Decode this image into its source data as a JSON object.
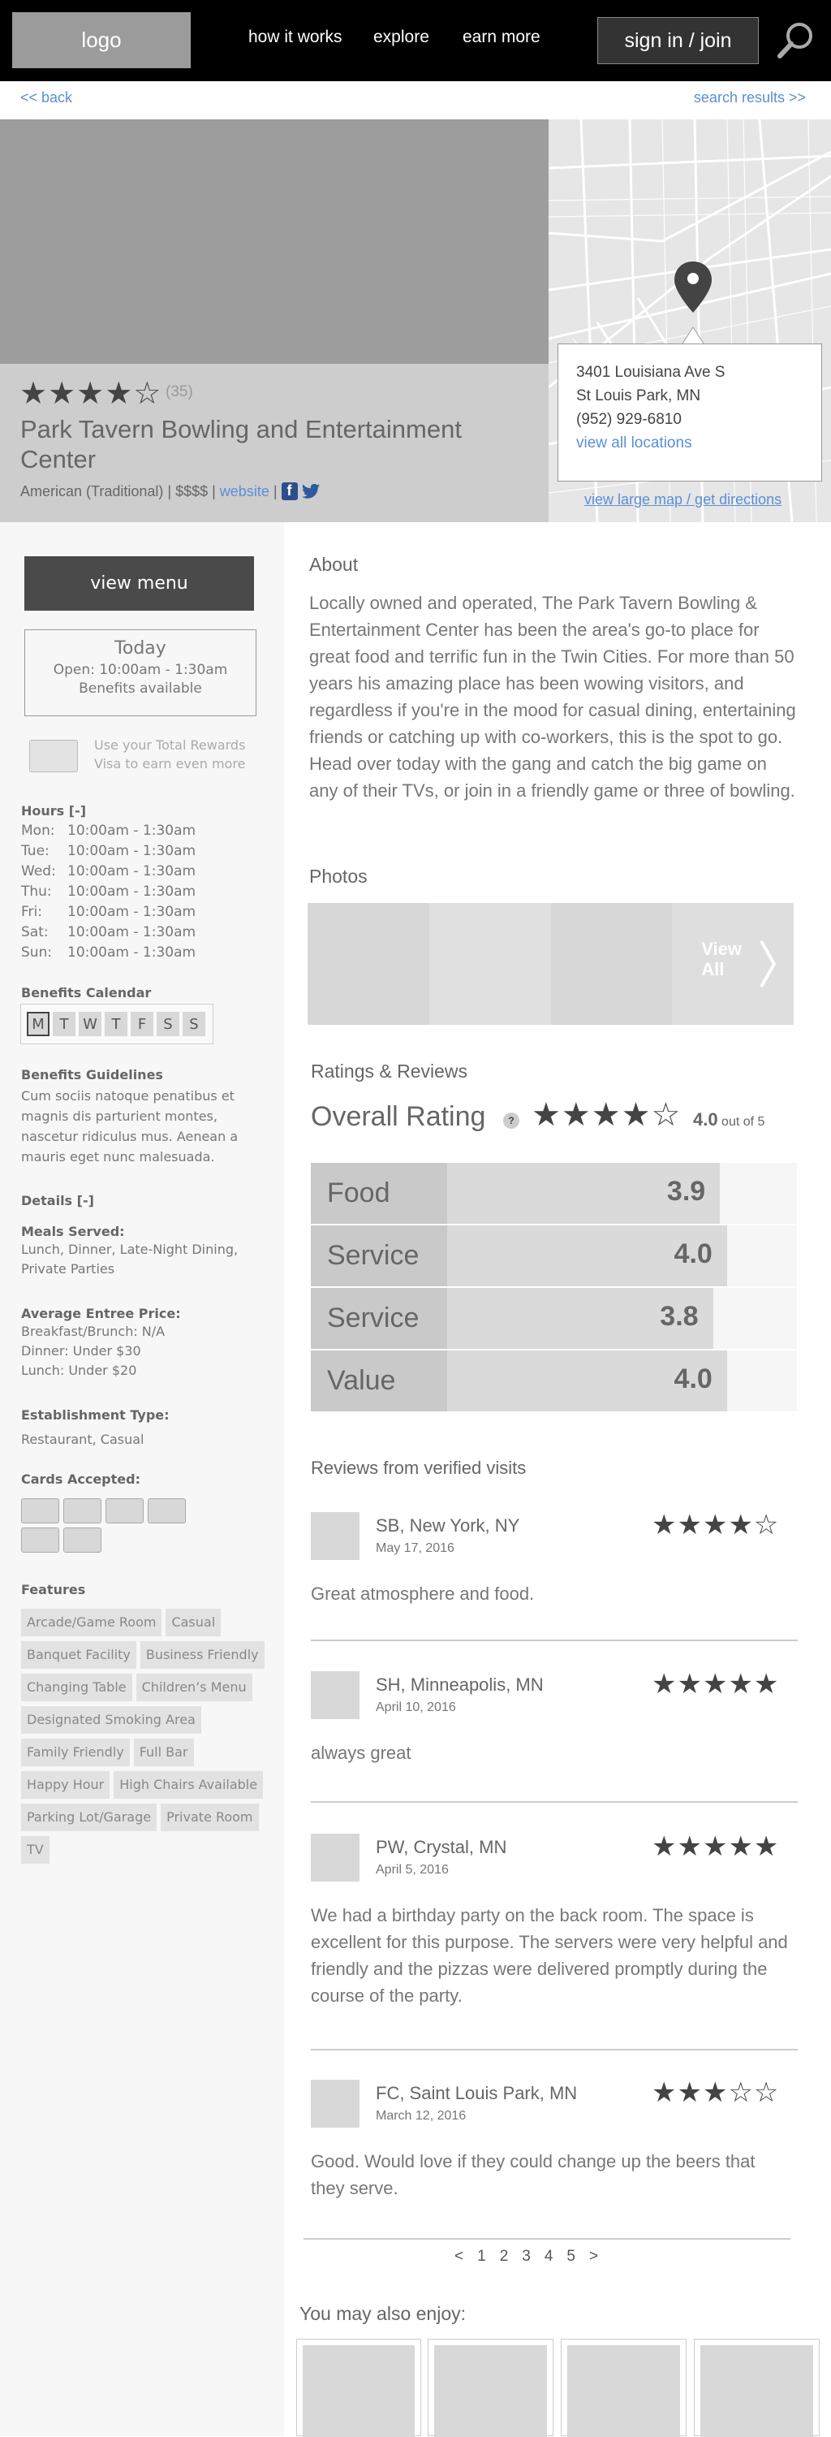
{
  "header": {
    "logo": "logo",
    "nav": [
      "how it works",
      "explore",
      "earn more"
    ],
    "signin": "sign in / join",
    "search_icon": "search-icon"
  },
  "subnav": {
    "back": "<< back",
    "results": "search results >>"
  },
  "venue": {
    "stars": "★★★★☆",
    "rating": 4,
    "review_count": "(35)",
    "name": "Park Tavern Bowling and Entertainment Center",
    "cuisine": "American (Traditional) | $$$$ |",
    "website": "website",
    "sep": "|"
  },
  "location": {
    "address1": "3401 Louisiana Ave S",
    "address2": "St Louis Park, MN",
    "phone": "(952) 929-6810",
    "all_locations": "view all locations",
    "large_map": "view large map / get directions"
  },
  "sidebar": {
    "menu_button": "view menu",
    "today": {
      "title": "Today",
      "open": "Open: 10:00am - 1:30am",
      "benefits": "Benefits available"
    },
    "rewards": "Use your Total Rewards Visa to earn even more",
    "hours_title": "Hours [-]",
    "hours": [
      {
        "day": "Mon:",
        "time": "10:00am - 1:30am"
      },
      {
        "day": "Tue:",
        "time": "10:00am - 1:30am"
      },
      {
        "day": "Wed:",
        "time": "10:00am - 1:30am"
      },
      {
        "day": "Thu:",
        "time": "10:00am - 1:30am"
      },
      {
        "day": "Fri:",
        "time": "10:00am - 1:30am"
      },
      {
        "day": "Sat:",
        "time": "10:00am - 1:30am"
      },
      {
        "day": "Sun:",
        "time": "10:00am - 1:30am"
      }
    ],
    "calendar_title": "Benefits Calendar",
    "calendar_days": [
      "M",
      "T",
      "W",
      "T",
      "F",
      "S",
      "S"
    ],
    "guidelines_title": "Benefits Guidelines",
    "guidelines": "Cum sociis natoque penatibus et magnis dis parturient montes, nascetur ridiculus mus. Aenean a mauris eget nunc malesuada.",
    "details_title": "Details [-]",
    "meals_title": "Meals Served:",
    "meals": "Lunch, Dinner, Late-Night Dining, Private Parties",
    "price_title": "Average Entree Price:",
    "prices": [
      "Breakfast/Brunch: N/A",
      "Dinner: Under $30",
      "Lunch: Under $20"
    ],
    "type_title": "Establishment Type:",
    "type": "Restaurant, Casual",
    "cards_title": "Cards Accepted:",
    "features_title": "Features",
    "features": [
      "Arcade/Game Room",
      "Casual",
      "Banquet Facility",
      "Business Friendly",
      "Changing Table",
      "Children’s Menu",
      "Designated Smoking Area",
      "Family Friendly",
      "Full Bar",
      "Happy Hour",
      "High Chairs Available",
      "Parking Lot/Garage",
      "Private Room",
      "TV"
    ]
  },
  "main": {
    "about_title": "About",
    "about": "Locally owned and operated, The Park Tavern Bowling & Entertainment Center has been the area's go-to place for great food and terrific fun in the Twin Cities. For more than 50 years his amazing place has been wowing visitors, and regardless if you're in the mood for casual dining, entertaining friends or catching up with co-workers, this is the spot to go. Head over today with the gang and catch the big game on any of their TVs, or join in a friendly game or three of bowling.",
    "photos_title": "Photos",
    "view_all": "View All",
    "ratings_title": "Ratings & Reviews",
    "overall_label": "Overall Rating",
    "help": "?",
    "overall_stars": "★★★★☆",
    "overall_value": "4.0",
    "overall_suffix": "out of 5",
    "categories": [
      {
        "label": "Food",
        "value": "3.9"
      },
      {
        "label": "Service",
        "value": "4.0"
      },
      {
        "label": "Service",
        "value": "3.8"
      },
      {
        "label": "Value",
        "value": "4.0"
      }
    ],
    "reviews_title": "Reviews from verified visits",
    "reviews": [
      {
        "name": "SB, New York, NY",
        "date": "May 17, 2016",
        "stars": "★★★★☆",
        "rating": 4,
        "text": "Great atmosphere and food."
      },
      {
        "name": "SH, Minneapolis, MN",
        "date": "April 10, 2016",
        "stars": "★★★★★",
        "rating": 5,
        "text": "always great"
      },
      {
        "name": "PW, Crystal, MN",
        "date": "April 5, 2016",
        "stars": "★★★★★",
        "rating": 5,
        "text": "We had a birthday party on the back room. The space is excellent for this purpose. The servers were very helpful and friendly and the pizzas were delivered promptly during the course of the party."
      },
      {
        "name": "FC, Saint Louis Park, MN",
        "date": "March 12, 2016",
        "stars": "★★★☆☆",
        "rating": 3,
        "text": "Good. Would love if they could change up the beers that they serve."
      }
    ],
    "pager": [
      "<",
      "1",
      "2",
      "3",
      "4",
      "5",
      ">"
    ],
    "enjoy_title": "You may also enjoy:"
  },
  "colors": {
    "link": "#5b8fd6",
    "header": "#000000",
    "button": "#4a4a4a",
    "star": "#444444"
  }
}
